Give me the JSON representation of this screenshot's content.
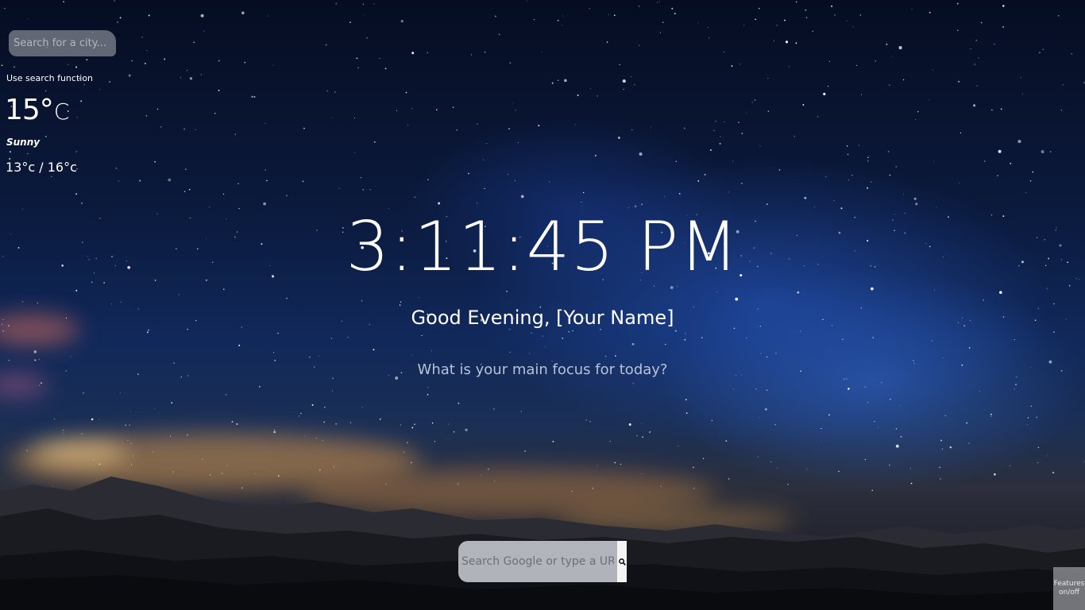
{
  "weather": {
    "city_search_placeholder": "Search for a city...",
    "search_hint": "Use search function",
    "temperature": "15°",
    "unit": "C",
    "condition": "Sunny",
    "range": "13°c / 16°c"
  },
  "clock": {
    "time": "3:11:45 PM"
  },
  "greeting": {
    "text": "Good Evening, [Your Name]",
    "focus_question": "What is your main focus for today?"
  },
  "search": {
    "placeholder": "Search Google or type a URL",
    "button_icon": "search-icon"
  },
  "toggle": {
    "label": "Features on/off"
  },
  "background": {
    "description_icon": "night-sky-wallpaper",
    "accent": "#ffffff"
  }
}
